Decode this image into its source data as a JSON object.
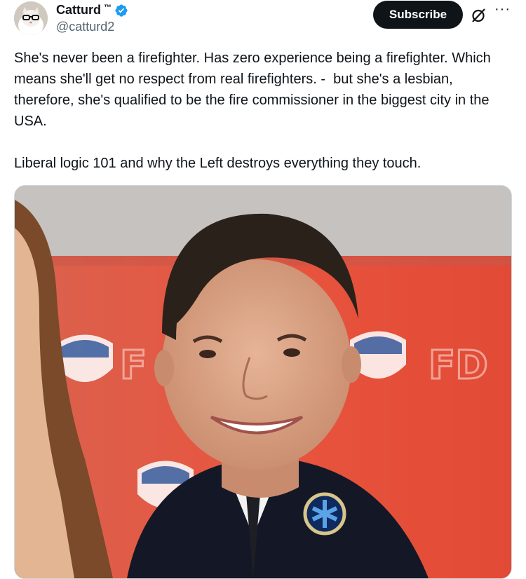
{
  "author": {
    "display_name": "Catturd",
    "trademark": "™",
    "handle": "@catturd2",
    "verified": true
  },
  "actions": {
    "subscribe_label": "Subscribe",
    "grok_icon": "grok-icon",
    "more_icon": "more-icon",
    "more_glyph": "···"
  },
  "tweet": {
    "text": "She's never been a firefighter. Has zero experience being a firefighter. Which means she'll get no respect from real firefighters. -  but she's a lesbian, therefore, she's qualified to be the fire commissioner in the biggest city in the USA.\n\nLiberal logic 101 and why the Left destroys everything they touch."
  },
  "colors": {
    "text": "#0f1419",
    "secondary": "#536471",
    "verified_blue": "#1d9bf0",
    "subscribe_bg": "#0f1419",
    "backdrop_red": "#e8553f"
  }
}
